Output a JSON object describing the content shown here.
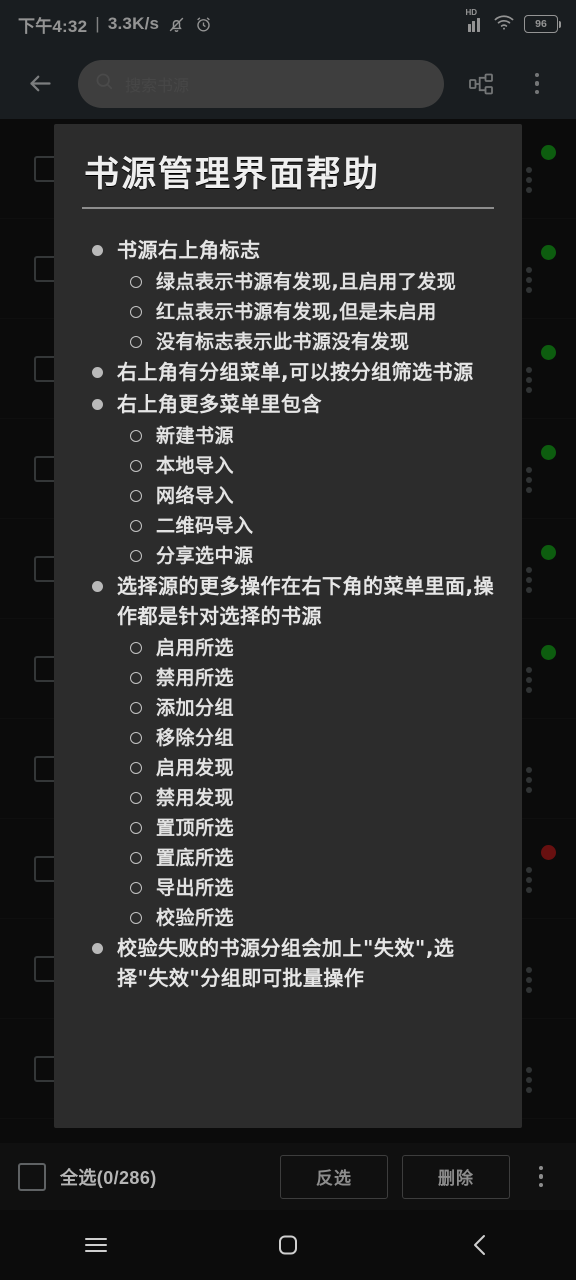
{
  "status_bar": {
    "time": "下午4:32",
    "separator": "|",
    "network_speed": "3.3K/s",
    "mute_icon": "mute-bell-icon",
    "alarm_icon": "alarm-clock-icon",
    "hd_label": "HD",
    "signal_icon": "cellular-signal-icon",
    "wifi_icon": "wifi-icon",
    "battery_level": "96"
  },
  "app_bar": {
    "back_icon": "back-arrow-icon",
    "search_placeholder": "搜索书源",
    "search_value": "",
    "search_icon": "search-icon",
    "group_icon": "group-filter-icon",
    "more_icon": "overflow-menu-icon"
  },
  "dialog": {
    "title": "书源管理界面帮助",
    "sections": [
      {
        "bullet": "书源右上角标志",
        "items": [
          "绿点表示书源有发现,且启用了发现",
          "红点表示书源有发现,但是未启用",
          "没有标志表示此书源没有发现"
        ]
      },
      {
        "bullet": "右上角有分组菜单,可以按分组筛选书源",
        "items": []
      },
      {
        "bullet": "右上角更多菜单里包含",
        "items": [
          "新建书源",
          "本地导入",
          "网络导入",
          "二维码导入",
          "分享选中源"
        ]
      },
      {
        "bullet": "选择源的更多操作在右下角的菜单里面,操作都是针对选择的书源",
        "items": [
          "启用所选",
          "禁用所选",
          "添加分组",
          "移除分组",
          "启用发现",
          "禁用发现",
          "置顶所选",
          "置底所选",
          "导出所选",
          "校验所选"
        ]
      },
      {
        "bullet": "校验失败的书源分组会加上\"失效\",选择\"失效\"分组即可批量操作",
        "items": []
      }
    ]
  },
  "background_list": {
    "rows": [
      {
        "checkbox": "unchecked",
        "status_dot": "green",
        "more_icon": "row-overflow-icon"
      },
      {
        "checkbox": "unchecked",
        "status_dot": "green",
        "more_icon": "row-overflow-icon"
      },
      {
        "checkbox": "unchecked",
        "status_dot": "green",
        "more_icon": "row-overflow-icon"
      },
      {
        "checkbox": "unchecked",
        "status_dot": "green",
        "more_icon": "row-overflow-icon"
      },
      {
        "checkbox": "unchecked",
        "status_dot": "green",
        "more_icon": "row-overflow-icon"
      },
      {
        "checkbox": "unchecked",
        "status_dot": "green",
        "more_icon": "row-overflow-icon"
      },
      {
        "checkbox": "unchecked",
        "status_dot": "none",
        "more_icon": "row-overflow-icon"
      },
      {
        "checkbox": "unchecked",
        "status_dot": "red",
        "more_icon": "row-overflow-icon"
      },
      {
        "checkbox": "unchecked",
        "status_dot": "none",
        "more_icon": "row-overflow-icon"
      },
      {
        "checkbox": "unchecked",
        "status_dot": "none",
        "more_icon": "row-overflow-icon"
      }
    ]
  },
  "bottom_bar": {
    "select_all_checkbox": "unchecked",
    "select_all_label": "全选(0/286)",
    "invert_label": "反选",
    "delete_label": "删除",
    "more_icon": "overflow-menu-icon"
  },
  "nav_bar": {
    "recents_icon": "recents-menu-icon",
    "home_icon": "home-square-icon",
    "back_icon": "back-chevron-icon"
  },
  "colors": {
    "status_green": "#17a11b",
    "status_red": "#b41c1c",
    "appbar_bg": "#2b3338",
    "dialog_bg": "#2c2c2c",
    "list_bg": "#131313"
  }
}
